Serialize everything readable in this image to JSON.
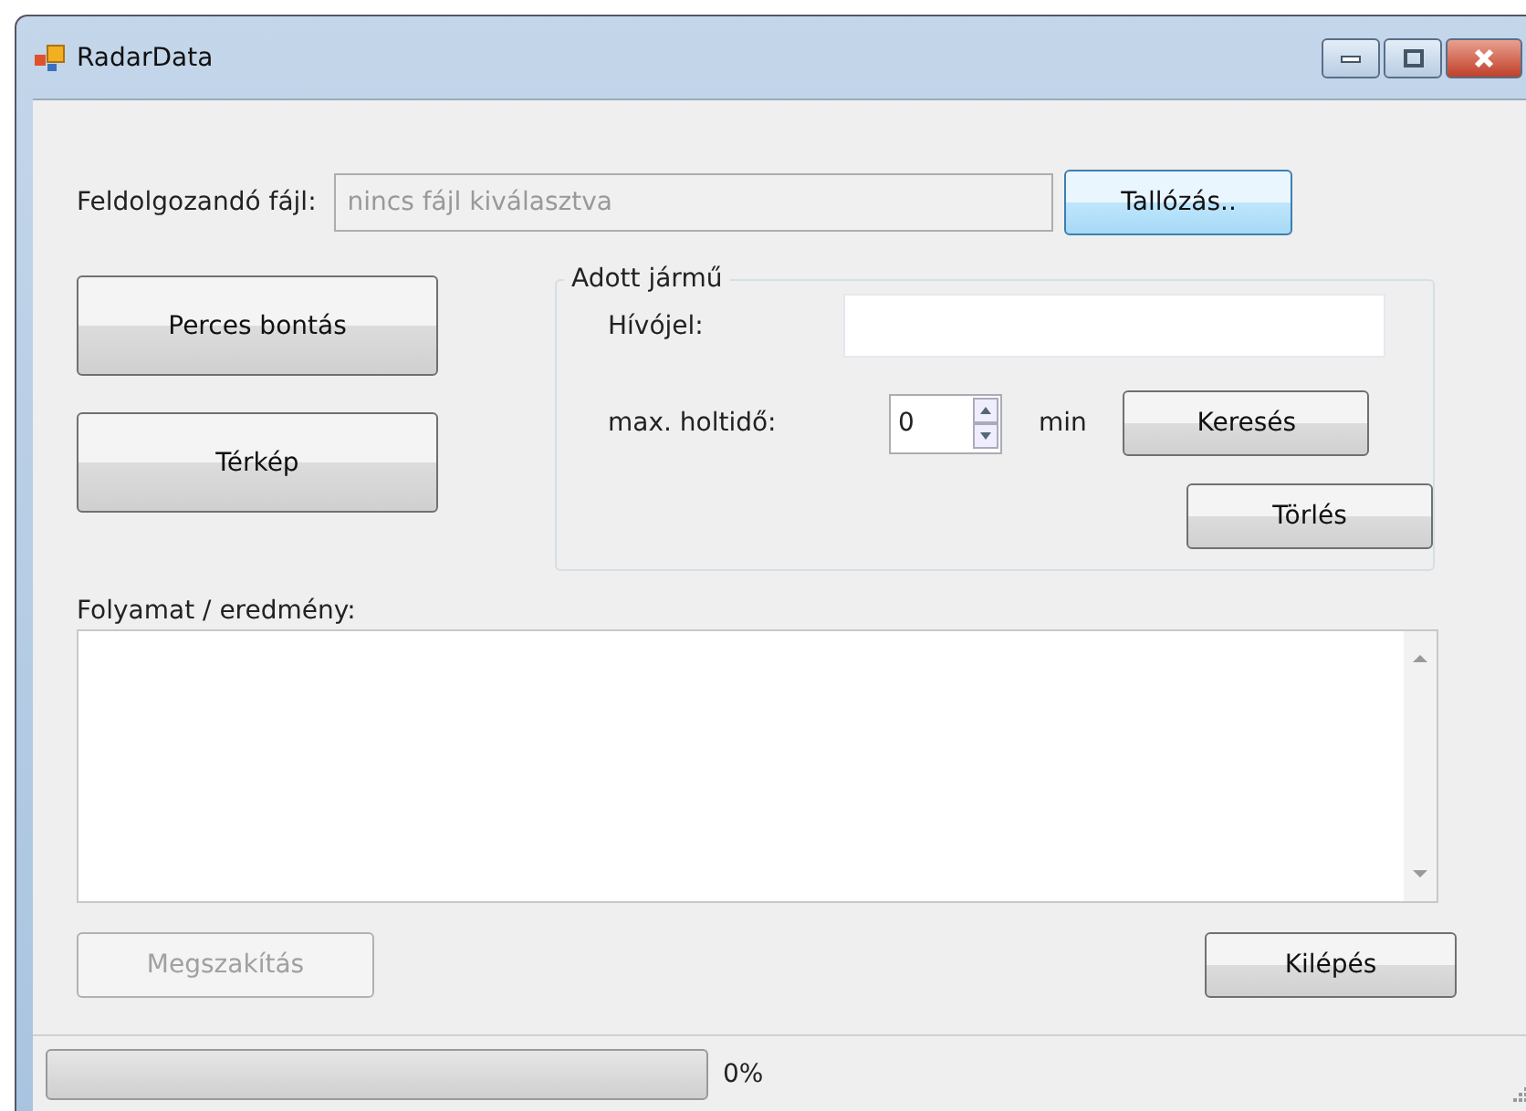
{
  "window": {
    "title": "RadarData"
  },
  "file_row": {
    "label": "Feldolgozandó fájl:",
    "placeholder": "nincs fájl kiválasztva",
    "browse_button": "Tallózás.."
  },
  "left_buttons": [
    "Perces bontás",
    "Térkép"
  ],
  "vehicle_group": {
    "title": "Adott jármű",
    "callsign_label": "Hívójel:",
    "deadtime_label": "max. holtidő:",
    "deadtime_value": "0",
    "unit": "min",
    "search_button": "Keresés",
    "clear_button": "Törlés"
  },
  "output": {
    "label": "Folyamat / eredmény:"
  },
  "buttons": [
    {
      "label": "Megszakítás",
      "disabled": true
    },
    {
      "label": "Kilépés",
      "disabled": false
    }
  ],
  "status_bar": {
    "progress": {
      "level": 0
    },
    "percent": "0%"
  }
}
